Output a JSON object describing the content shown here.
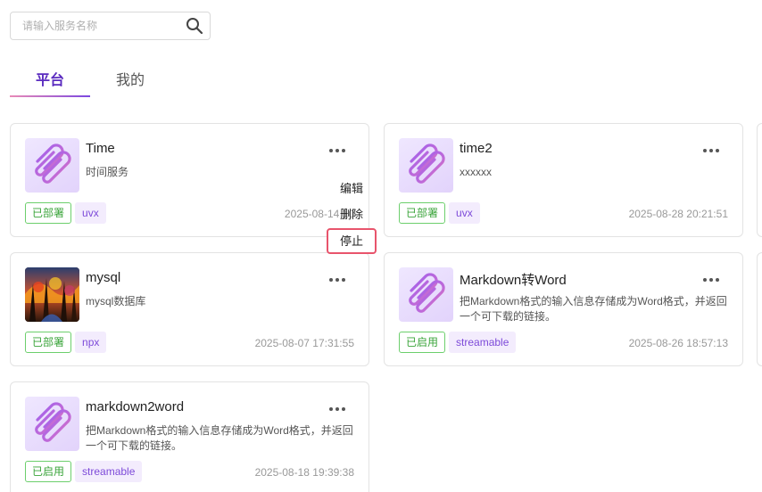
{
  "search": {
    "placeholder": "请输入服务名称",
    "value": "",
    "icon": "search-icon"
  },
  "tabs": [
    {
      "label": "平台",
      "active": true
    },
    {
      "label": "我的",
      "active": false
    }
  ],
  "colors": {
    "accent": "#5a2bbf",
    "status_green": "#3aa43a",
    "type_tag_bg": "#f3ecfd",
    "menu_highlight": "#e8546c"
  },
  "cards": [
    {
      "title": "Time",
      "description": "时间服务",
      "status": "已部署",
      "type": "uvx",
      "date": "2025-08-14 10"
    },
    {
      "title": "time2",
      "description": "xxxxxx",
      "status": "已部署",
      "type": "uvx",
      "date": "2025-08-28 20:21:51"
    },
    {
      "title": "mysql",
      "description": "mysql数据库",
      "status": "已部署",
      "type": "npx",
      "date": "2025-08-07 17:31:55"
    },
    {
      "title": "Markdown转Word",
      "description": "把Markdown格式的输入信息存储成为Word格式，并返回一个可下载的链接。",
      "status": "已启用",
      "type": "streamable",
      "date": "2025-08-26 18:57:13"
    },
    {
      "title": "markdown2word",
      "description": "把Markdown格式的输入信息存储成为Word格式，并返回一个可下载的链接。",
      "status": "已启用",
      "type": "streamable",
      "date": "2025-08-18 19:39:38"
    }
  ],
  "context_menu": {
    "items": [
      "编辑",
      "删除",
      "停止"
    ],
    "highlighted": "停止"
  }
}
